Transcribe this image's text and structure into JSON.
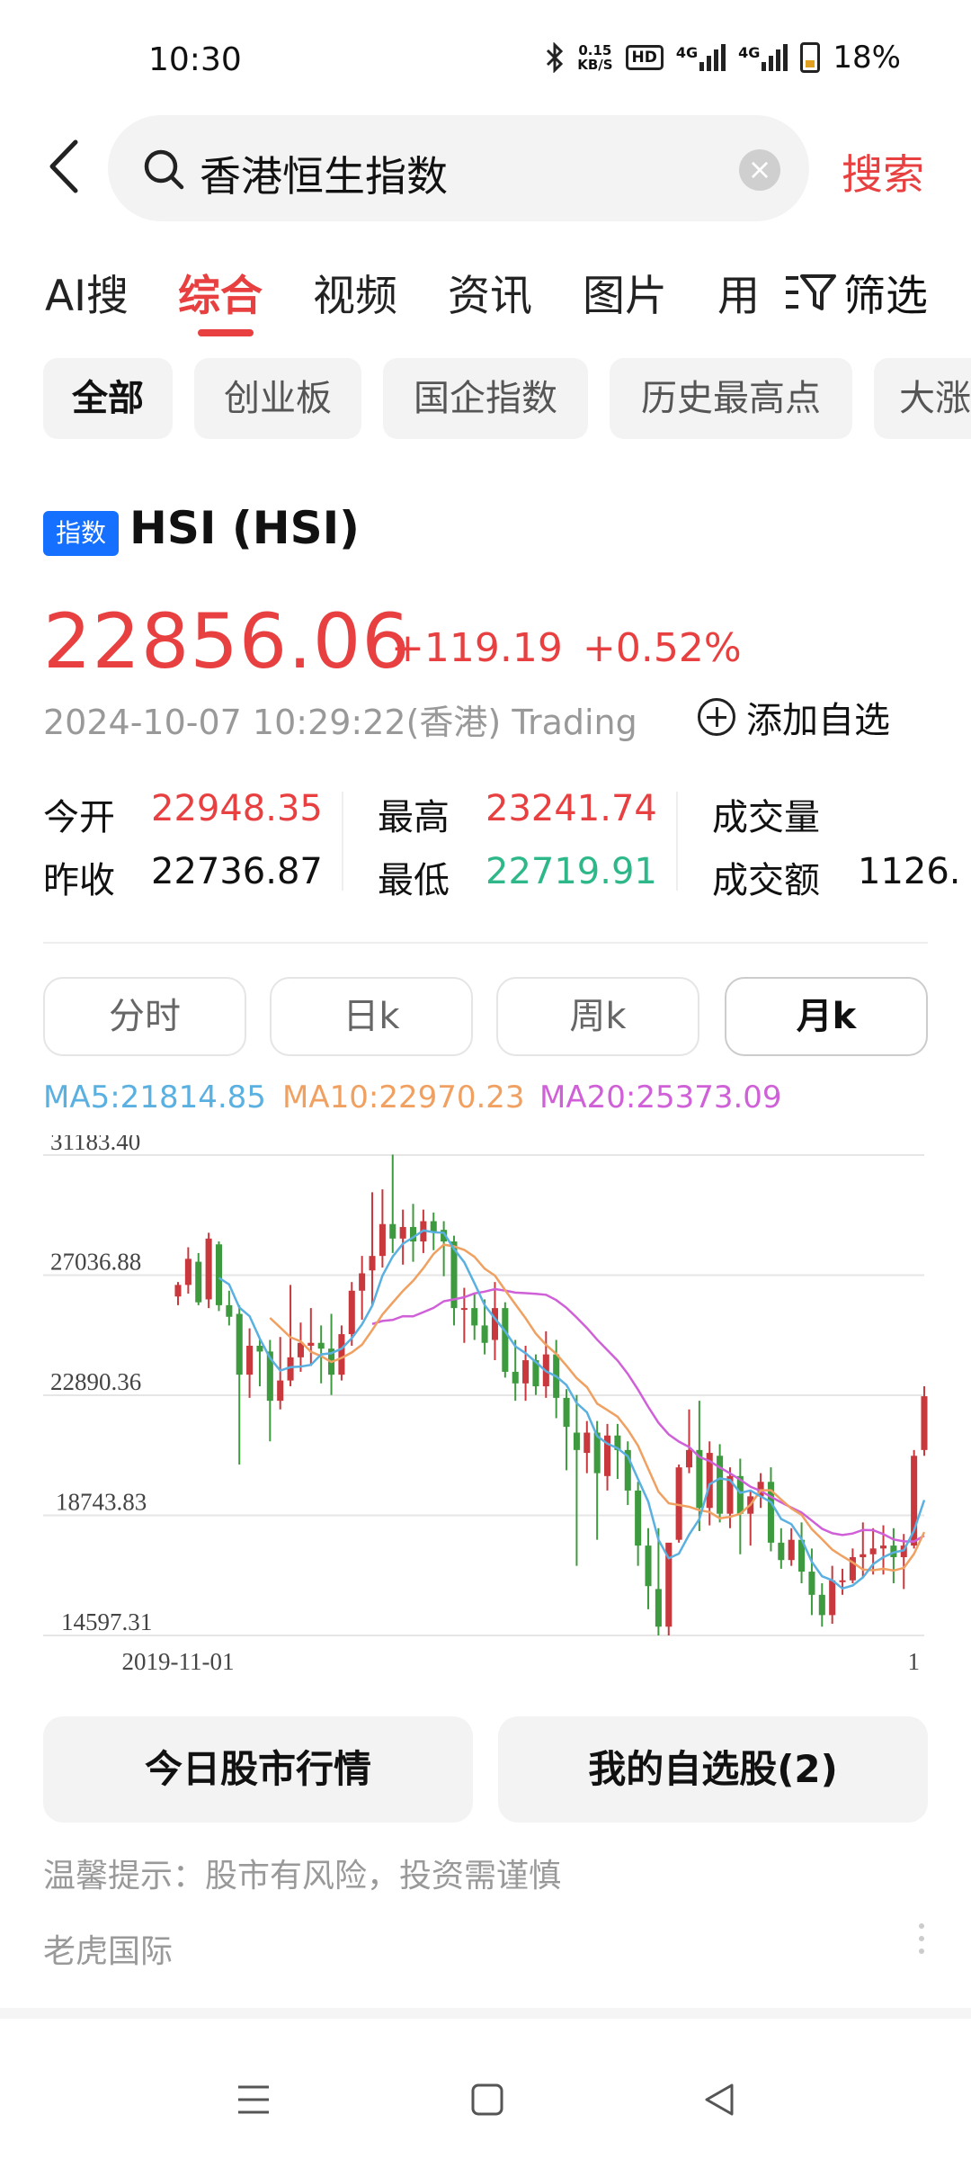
{
  "status": {
    "time": "10:30",
    "net_speed_top": "0.15",
    "net_speed_bottom": "KB/S",
    "hd_label": "HD",
    "sig1_label": "4G",
    "sig2_label": "4G",
    "battery_pct": "18%"
  },
  "search": {
    "query": "香港恒生指数",
    "button_label": "搜索"
  },
  "tabs": [
    {
      "label": "AI搜"
    },
    {
      "label": "综合"
    },
    {
      "label": "视频"
    },
    {
      "label": "资讯"
    },
    {
      "label": "图片"
    },
    {
      "label": "用"
    }
  ],
  "filter_label": "筛选",
  "chips": [
    {
      "label": "全部"
    },
    {
      "label": "创业板"
    },
    {
      "label": "国企指数"
    },
    {
      "label": "历史最高点"
    },
    {
      "label": "大涨"
    }
  ],
  "stock": {
    "badge": "指数",
    "name": "HSI (HSI)",
    "price": "22856.06",
    "change": "+119.19",
    "change_pct": "+0.52%",
    "timestamp": "2024-10-07 10:29:22(香港) Trading",
    "add_watch_label": "添加自选"
  },
  "stats": {
    "open_label": "今开",
    "open": "22948.35",
    "prev_label": "昨收",
    "prev": "22736.87",
    "high_label": "最高",
    "high": "23241.74",
    "low_label": "最低",
    "low": "22719.91",
    "vol_label": "成交量",
    "vol": "",
    "amt_label": "成交额",
    "amt": "1126."
  },
  "periods": [
    {
      "label": "分时"
    },
    {
      "label": "日k"
    },
    {
      "label": "周k"
    },
    {
      "label": "月k"
    }
  ],
  "ma": {
    "ma5": "MA5:21814.85",
    "ma10": "MA10:22970.23",
    "ma20": "MA20:25373.09"
  },
  "colors": {
    "up": "#e84040",
    "down": "#2eb88a",
    "candle_up": "#c8383c",
    "candle_down": "#3e9a3e",
    "ma5": "#5ab0e0",
    "ma10": "#f0a060",
    "ma20": "#d060d8"
  },
  "chart_data": {
    "type": "candlestick",
    "ylim": [
      14597.31,
      31183.4
    ],
    "y_ticks": [
      "31183.40",
      "27036.88",
      "22890.36",
      "18743.83",
      "14597.31"
    ],
    "x_start_label": "2019-11-01",
    "x_end_label": "1",
    "candles": [
      {
        "o": 26300,
        "h": 26800,
        "l": 26000,
        "c": 26700
      },
      {
        "o": 26700,
        "h": 28000,
        "l": 26400,
        "c": 27600
      },
      {
        "o": 27500,
        "h": 27800,
        "l": 26000,
        "c": 26100
      },
      {
        "o": 26200,
        "h": 28500,
        "l": 25900,
        "c": 28300
      },
      {
        "o": 28100,
        "h": 28200,
        "l": 25800,
        "c": 26000
      },
      {
        "o": 26000,
        "h": 26500,
        "l": 25300,
        "c": 25600
      },
      {
        "o": 25700,
        "h": 26000,
        "l": 20500,
        "c": 23600
      },
      {
        "o": 23600,
        "h": 25200,
        "l": 22800,
        "c": 24600
      },
      {
        "o": 24600,
        "h": 24800,
        "l": 23200,
        "c": 24400
      },
      {
        "o": 24400,
        "h": 24800,
        "l": 21300,
        "c": 22700
      },
      {
        "o": 22700,
        "h": 24900,
        "l": 22400,
        "c": 23400
      },
      {
        "o": 23400,
        "h": 26700,
        "l": 23200,
        "c": 24200
      },
      {
        "o": 24200,
        "h": 25400,
        "l": 23700,
        "c": 24700
      },
      {
        "o": 24600,
        "h": 25900,
        "l": 23900,
        "c": 24700
      },
      {
        "o": 24700,
        "h": 25300,
        "l": 23300,
        "c": 24500
      },
      {
        "o": 24500,
        "h": 25700,
        "l": 22900,
        "c": 23600
      },
      {
        "o": 23600,
        "h": 25300,
        "l": 23400,
        "c": 25000
      },
      {
        "o": 25000,
        "h": 26800,
        "l": 24600,
        "c": 26500
      },
      {
        "o": 26500,
        "h": 27700,
        "l": 25500,
        "c": 27100
      },
      {
        "o": 27200,
        "h": 29900,
        "l": 26000,
        "c": 27700
      },
      {
        "o": 27700,
        "h": 30000,
        "l": 27300,
        "c": 28800
      },
      {
        "o": 28800,
        "h": 31200,
        "l": 27800,
        "c": 28300
      },
      {
        "o": 28300,
        "h": 29300,
        "l": 27400,
        "c": 28700
      },
      {
        "o": 28700,
        "h": 29500,
        "l": 27500,
        "c": 28200
      },
      {
        "o": 28200,
        "h": 29300,
        "l": 27800,
        "c": 28900
      },
      {
        "o": 28900,
        "h": 29200,
        "l": 27900,
        "c": 28500
      },
      {
        "o": 28600,
        "h": 28900,
        "l": 27000,
        "c": 28200
      },
      {
        "o": 28200,
        "h": 28400,
        "l": 25300,
        "c": 25900
      },
      {
        "o": 25900,
        "h": 26600,
        "l": 24700,
        "c": 25900
      },
      {
        "o": 25900,
        "h": 26400,
        "l": 24800,
        "c": 25300
      },
      {
        "o": 25300,
        "h": 26200,
        "l": 24300,
        "c": 24700
      },
      {
        "o": 24800,
        "h": 26800,
        "l": 24100,
        "c": 25900
      },
      {
        "o": 25900,
        "h": 26100,
        "l": 23500,
        "c": 23700
      },
      {
        "o": 23700,
        "h": 24800,
        "l": 22700,
        "c": 23300
      },
      {
        "o": 23300,
        "h": 24600,
        "l": 22700,
        "c": 24100
      },
      {
        "o": 24100,
        "h": 24300,
        "l": 22900,
        "c": 23200
      },
      {
        "o": 23200,
        "h": 25100,
        "l": 22800,
        "c": 24300
      },
      {
        "o": 24300,
        "h": 24800,
        "l": 22100,
        "c": 22800
      },
      {
        "o": 22800,
        "h": 23100,
        "l": 20300,
        "c": 21800
      },
      {
        "o": 21600,
        "h": 22900,
        "l": 17000,
        "c": 21000
      },
      {
        "o": 20900,
        "h": 22000,
        "l": 20200,
        "c": 21600
      },
      {
        "o": 21600,
        "h": 22000,
        "l": 17900,
        "c": 20200
      },
      {
        "o": 20100,
        "h": 21900,
        "l": 19600,
        "c": 21500
      },
      {
        "o": 21500,
        "h": 21900,
        "l": 20000,
        "c": 21000
      },
      {
        "o": 21000,
        "h": 21300,
        "l": 19100,
        "c": 19600
      },
      {
        "o": 19600,
        "h": 19900,
        "l": 17000,
        "c": 17700
      },
      {
        "o": 17700,
        "h": 18300,
        "l": 15500,
        "c": 16300
      },
      {
        "o": 16200,
        "h": 18300,
        "l": 14597,
        "c": 14900
      },
      {
        "o": 14900,
        "h": 16200,
        "l": 14597,
        "c": 17800
      },
      {
        "o": 17900,
        "h": 20500,
        "l": 17800,
        "c": 20400
      },
      {
        "o": 20400,
        "h": 22400,
        "l": 20200,
        "c": 21000
      },
      {
        "o": 21000,
        "h": 22700,
        "l": 18200,
        "c": 19000
      },
      {
        "o": 19000,
        "h": 21300,
        "l": 18400,
        "c": 20900
      },
      {
        "o": 20800,
        "h": 21200,
        "l": 18500,
        "c": 18800
      },
      {
        "o": 18800,
        "h": 20400,
        "l": 18300,
        "c": 20100
      },
      {
        "o": 20100,
        "h": 20700,
        "l": 17400,
        "c": 18800
      },
      {
        "o": 18800,
        "h": 19600,
        "l": 17700,
        "c": 19400
      },
      {
        "o": 19400,
        "h": 20200,
        "l": 19000,
        "c": 19900
      },
      {
        "o": 19900,
        "h": 20400,
        "l": 17500,
        "c": 17800
      },
      {
        "o": 17800,
        "h": 18300,
        "l": 16900,
        "c": 17200
      },
      {
        "o": 17200,
        "h": 18300,
        "l": 17000,
        "c": 17900
      },
      {
        "o": 17900,
        "h": 18500,
        "l": 16400,
        "c": 16800
      },
      {
        "o": 16800,
        "h": 17600,
        "l": 15300,
        "c": 16000
      },
      {
        "o": 16000,
        "h": 16400,
        "l": 14900,
        "c": 15300
      },
      {
        "o": 15300,
        "h": 17000,
        "l": 15000,
        "c": 16500
      },
      {
        "o": 16500,
        "h": 16900,
        "l": 16000,
        "c": 16500
      },
      {
        "o": 16500,
        "h": 17600,
        "l": 16400,
        "c": 17300
      },
      {
        "o": 17300,
        "h": 18500,
        "l": 16600,
        "c": 17400
      },
      {
        "o": 17400,
        "h": 18300,
        "l": 16700,
        "c": 17600
      },
      {
        "o": 17600,
        "h": 18400,
        "l": 16700,
        "c": 17700
      },
      {
        "o": 17700,
        "h": 18300,
        "l": 16400,
        "c": 17300
      },
      {
        "o": 17300,
        "h": 18100,
        "l": 16200,
        "c": 17700
      },
      {
        "o": 17700,
        "h": 21000,
        "l": 17600,
        "c": 20800
      },
      {
        "o": 21000,
        "h": 23200,
        "l": 20800,
        "c": 22856
      }
    ]
  },
  "buttons": {
    "market_today": "今日股市行情",
    "my_watchlist": "我的自选股(2)"
  },
  "tip": "温馨提示：股市有风险，投资需谨慎",
  "source": "老虎国际"
}
